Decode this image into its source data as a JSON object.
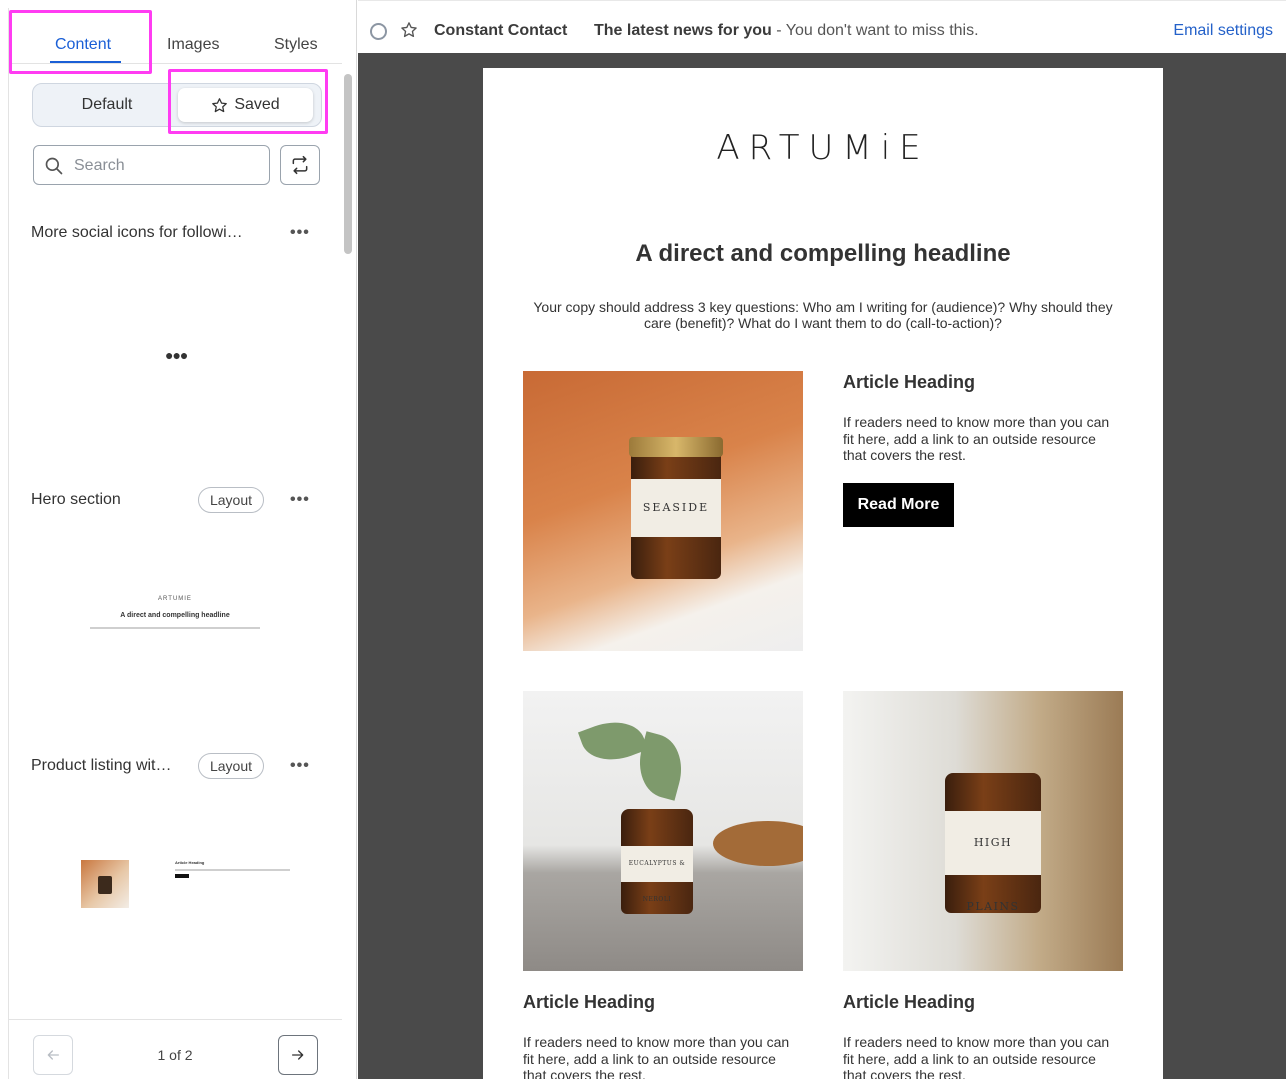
{
  "sidebar": {
    "tabs": [
      {
        "label": "Content"
      },
      {
        "label": "Images"
      },
      {
        "label": "Styles"
      }
    ],
    "segment": {
      "default_label": "Default",
      "saved_label": "Saved"
    },
    "search": {
      "placeholder": "Search"
    },
    "items": [
      {
        "title": "More social icons for followi…",
        "badge": "",
        "menu": "•••"
      },
      {
        "title": "Hero section",
        "badge": "Layout",
        "menu": "•••"
      },
      {
        "title": "Product listing wit…",
        "badge": "Layout",
        "menu": "•••"
      }
    ],
    "loading_glyph": "●●●",
    "hero_preview": {
      "logo": "ARTUMIE",
      "headline": "A direct and compelling headline"
    },
    "product_preview": {
      "heading": "Article Heading"
    },
    "pager": {
      "label": "1 of 2"
    },
    "accent_color": "#1a5fd6",
    "highlight_color": "#ff3cf2"
  },
  "topbar": {
    "sender": "Constant Contact",
    "subject": "The latest news for you",
    "preheader": " - You don't want to miss this.",
    "settings_link": "Email settings"
  },
  "email": {
    "brand": "ARTUMiE",
    "headline": "A direct and compelling headline",
    "intro": "Your copy should address 3 key questions: Who am I writing for (audience)? Why should they care (benefit)? What do I want them to do (call-to-action)?",
    "articles": [
      {
        "heading": "Article Heading",
        "body": "If readers need to know more than you can fit here, add a link to an outside resource that covers the rest.",
        "button": "Read More",
        "jar_label": "SEASIDE"
      },
      {
        "heading": "Article Heading",
        "body": "If readers need to know more than you can fit here, add a link to an outside resource that covers the rest.",
        "jar_label": "EUCALYPTUS & NEROLI"
      },
      {
        "heading": "Article Heading",
        "body": "If readers need to know more than you can fit here, add a link to an outside resource that covers the rest.",
        "jar_label": "HIGH PLAINS"
      }
    ]
  }
}
